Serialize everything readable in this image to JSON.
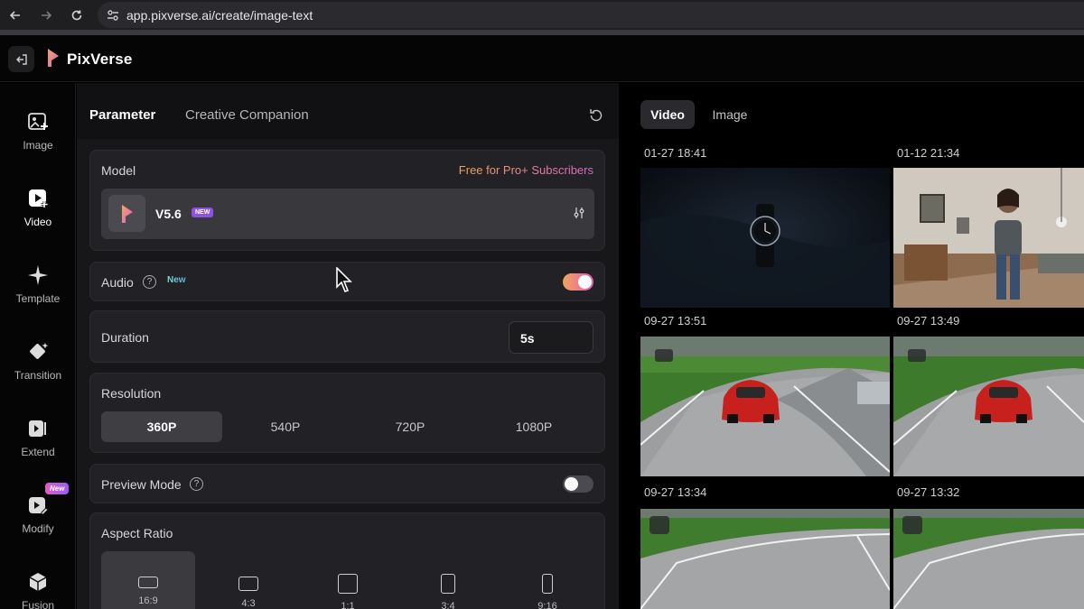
{
  "browser": {
    "url": "app.pixverse.ai/create/image-text",
    "back_icon": "arrow-left-icon",
    "forward_icon": "arrow-right-icon",
    "reload_icon": "reload-icon"
  },
  "header": {
    "brand": "PixVerse"
  },
  "rail": {
    "items": [
      {
        "label": "Image",
        "icon": "image-plus-icon",
        "active": false
      },
      {
        "label": "Video",
        "icon": "video-play-icon",
        "active": true
      },
      {
        "label": "Template",
        "icon": "sparkle-icon",
        "active": false
      },
      {
        "label": "Transition",
        "icon": "transition-icon",
        "active": false
      },
      {
        "label": "Extend",
        "icon": "extend-icon",
        "active": false
      },
      {
        "label": "Modify",
        "icon": "modify-icon",
        "active": false,
        "badge": "New"
      },
      {
        "label": "Fusion",
        "icon": "cube-icon",
        "active": false
      }
    ]
  },
  "panel": {
    "tabs": {
      "parameter": "Parameter",
      "companion": "Creative Companion"
    },
    "model": {
      "label": "Model",
      "promo": "Free for Pro+ Subscribers",
      "name": "V5.6",
      "badge": "NEW"
    },
    "audio": {
      "label": "Audio",
      "help": "?",
      "badge": "New",
      "enabled": true
    },
    "duration": {
      "label": "Duration",
      "value": "5s"
    },
    "resolution": {
      "label": "Resolution",
      "options": [
        "360P",
        "540P",
        "720P",
        "1080P"
      ],
      "selected": "360P"
    },
    "preview": {
      "label": "Preview Mode",
      "help": "?",
      "enabled": false
    },
    "aspect_ratio": {
      "label": "Aspect Ratio",
      "options": [
        "16:9",
        "4:3",
        "1:1",
        "3:4",
        "9:16"
      ],
      "selected": "16:9"
    }
  },
  "gallery": {
    "tabs": {
      "video": "Video",
      "image": "Image"
    },
    "items": [
      {
        "timestamp": "01-27 18:41",
        "scene": "watch"
      },
      {
        "timestamp": "01-12 21:34",
        "scene": "room"
      },
      {
        "timestamp": "09-27 13:51",
        "scene": "race"
      },
      {
        "timestamp": "09-27 13:49",
        "scene": "race"
      },
      {
        "timestamp": "09-27 13:34",
        "scene": "track"
      },
      {
        "timestamp": "09-27 13:32",
        "scene": "track"
      }
    ]
  },
  "colors": {
    "accent_gradient_start": "#f2a35a",
    "accent_gradient_end": "#e45fb7",
    "new_badge": "#8f51e0"
  }
}
